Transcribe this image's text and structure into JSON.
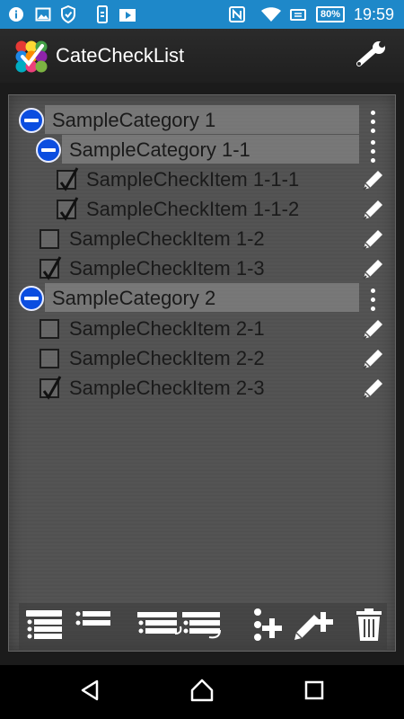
{
  "status_bar": {
    "time": "19:59",
    "battery": "80%",
    "icons": [
      "info-icon",
      "image-icon",
      "shield-icon",
      "phone-transfer-icon",
      "media-icon",
      "nfc-icon",
      "wifi-icon",
      "mute-icon",
      "battery-icon"
    ]
  },
  "app_bar": {
    "title": "CateCheckList",
    "logo_icon": "app-logo-icon",
    "settings_icon": "wrench-icon"
  },
  "list": [
    {
      "type": "category",
      "label": "SampleCategory 1",
      "level": 0
    },
    {
      "type": "category",
      "label": "SampleCategory 1-1",
      "level": 1
    },
    {
      "type": "item",
      "label": "SampleCheckItem 1-1-1",
      "level": 2,
      "checked": true
    },
    {
      "type": "item",
      "label": "SampleCheckItem 1-1-2",
      "level": 2,
      "checked": true
    },
    {
      "type": "item",
      "label": "SampleCheckItem 1-2",
      "level": 1,
      "checked": false
    },
    {
      "type": "item",
      "label": "SampleCheckItem 1-3",
      "level": 1,
      "checked": true
    },
    {
      "type": "category",
      "label": "SampleCategory 2",
      "level": 0
    },
    {
      "type": "item",
      "label": "SampleCheckItem 2-1",
      "level": 1,
      "checked": false
    },
    {
      "type": "item",
      "label": "SampleCheckItem 2-2",
      "level": 1,
      "checked": false
    },
    {
      "type": "item",
      "label": "SampleCheckItem 2-3",
      "level": 1,
      "checked": true
    }
  ],
  "toolbar": {
    "buttons": [
      "expand-all-icon",
      "collapse-all-icon",
      "move-items-icon",
      "add-category-icon",
      "add-item-icon",
      "trash-icon"
    ]
  },
  "nav_bar": {
    "buttons": [
      "back-icon",
      "home-icon",
      "recents-icon"
    ]
  },
  "colors": {
    "status_bar": "#1e88c9",
    "category_button": "#0b4de0",
    "category_highlight": "#969696"
  }
}
